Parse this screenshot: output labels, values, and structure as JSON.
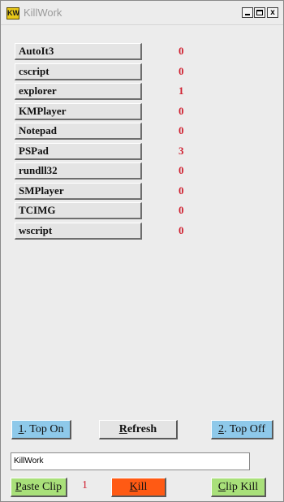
{
  "window": {
    "title": "KillWork",
    "icon_label": "KW",
    "close_glyph": "x"
  },
  "processes": [
    {
      "name": "AutoIt3",
      "count": "0"
    },
    {
      "name": "cscript",
      "count": "0"
    },
    {
      "name": "explorer",
      "count": "1"
    },
    {
      "name": "KMPlayer",
      "count": "0"
    },
    {
      "name": "Notepad",
      "count": "0"
    },
    {
      "name": "PSPad",
      "count": "3"
    },
    {
      "name": "rundll32",
      "count": "0"
    },
    {
      "name": "SMPlayer",
      "count": "0"
    },
    {
      "name": "TCIMG",
      "count": "0"
    },
    {
      "name": "wscript",
      "count": "0"
    }
  ],
  "controls": {
    "top_on": {
      "key": "1",
      "rest": ". Top On"
    },
    "refresh": {
      "key": "R",
      "rest": "efresh"
    },
    "top_off": {
      "key": "2",
      "rest": ". Top Off"
    },
    "path_value": "KillWork",
    "paste_clip": {
      "key": "P",
      "rest": "aste Clip"
    },
    "clip_count": "1",
    "kill": {
      "key": "K",
      "rest": "ill"
    },
    "clip_kill": {
      "key": "C",
      "rest": "lip Kill"
    }
  },
  "colors": {
    "count_red": "#d02030",
    "top_button_blue": "#8ec9ea",
    "clip_button_green": "#a9e07a",
    "kill_button_orange": "#ff5a14"
  }
}
